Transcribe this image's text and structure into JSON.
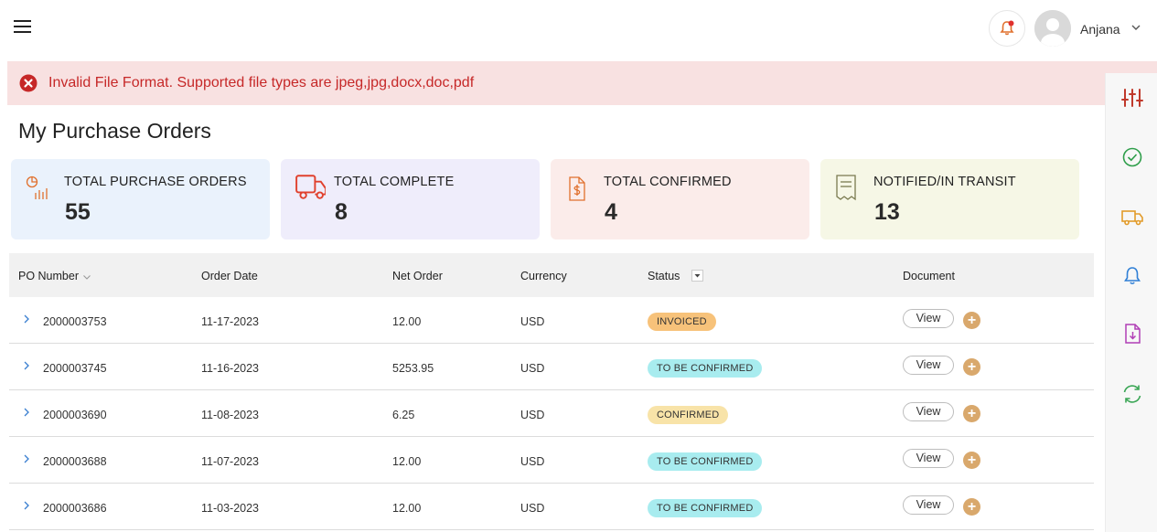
{
  "header": {
    "user_name": "Anjana"
  },
  "alert": {
    "message": "Invalid File Format. Supported file types are jpeg,jpg,docx,doc,pdf"
  },
  "page": {
    "title": "My Purchase Orders"
  },
  "cards": [
    {
      "label": "TOTAL PURCHASE ORDERS",
      "value": "55",
      "icon": "chart-icon",
      "bg": "#eaf2fc"
    },
    {
      "label": "TOTAL COMPLETE",
      "value": "8",
      "icon": "truck-icon",
      "bg": "#efedfb"
    },
    {
      "label": "TOTAL CONFIRMED",
      "value": "4",
      "icon": "invoice-dollar-icon",
      "bg": "#fbecea"
    },
    {
      "label": "NOTIFIED/IN TRANSIT",
      "value": "13",
      "icon": "receipt-icon",
      "bg": "#f6f7e6"
    }
  ],
  "table": {
    "headers": {
      "po_number": "PO Number",
      "order_date": "Order Date",
      "net_order": "Net Order",
      "currency": "Currency",
      "status": "Status",
      "document": "Document"
    },
    "view_label": "View",
    "plus_label": "+",
    "rows": [
      {
        "po": "2000003753",
        "date": "11-17-2023",
        "net": "12.00",
        "currency": "USD",
        "status": "INVOICED",
        "status_color": "#f7c27a"
      },
      {
        "po": "2000003745",
        "date": "11-16-2023",
        "net": "5253.95",
        "currency": "USD",
        "status": "TO BE CONFIRMED",
        "status_color": "#a8ecef"
      },
      {
        "po": "2000003690",
        "date": "11-08-2023",
        "net": "6.25",
        "currency": "USD",
        "status": "CONFIRMED",
        "status_color": "#f8e3a8"
      },
      {
        "po": "2000003688",
        "date": "11-07-2023",
        "net": "12.00",
        "currency": "USD",
        "status": "TO BE CONFIRMED",
        "status_color": "#a8ecef"
      },
      {
        "po": "2000003686",
        "date": "11-03-2023",
        "net": "12.00",
        "currency": "USD",
        "status": "TO BE CONFIRMED",
        "status_color": "#a8ecef"
      }
    ]
  },
  "rail": {
    "icons": [
      "sliders-icon",
      "check-circle-icon",
      "truck-icon",
      "bell-icon",
      "file-download-icon",
      "refresh-icon"
    ]
  },
  "colors": {
    "accent": "#d9a86c",
    "alert_text": "#c62828",
    "alert_bg": "#f8e1e1"
  }
}
